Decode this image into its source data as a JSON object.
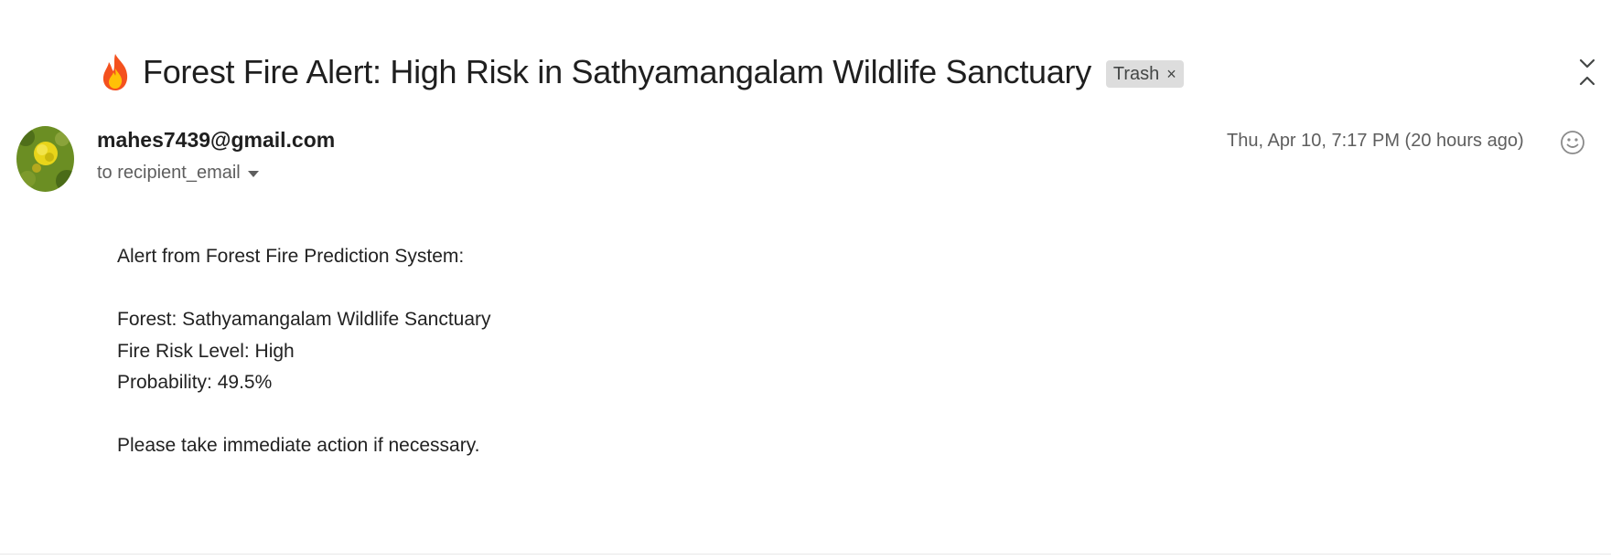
{
  "email": {
    "subject": "Forest Fire Alert: High Risk in Sathyamangalam Wildlife Sanctuary",
    "subject_icon": "fire-emoji",
    "label_chip": {
      "text": "Trash",
      "remove_glyph": "×"
    },
    "sender": "mahes7439@gmail.com",
    "recipient": "to recipient_email",
    "timestamp": "Thu, Apr 10, 7:17 PM (20 hours ago)",
    "body_lines": [
      "Alert from Forest Fire Prediction System:",
      "",
      "Forest: Sathyamangalam Wildlife Sanctuary",
      "Fire Risk Level: High",
      "Probability: 49.5%",
      "",
      "Please take immediate action if necessary."
    ]
  },
  "colors": {
    "chip_background": "#dddddd",
    "fire_orange": "#f4511e",
    "fire_yellow": "#ffc107",
    "avatar_green": "#6b8e23",
    "avatar_flower": "#e8d51a"
  }
}
